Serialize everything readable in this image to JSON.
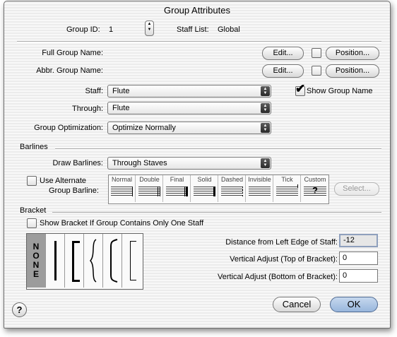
{
  "window": {
    "title": "Group Attributes"
  },
  "header": {
    "group_id_label": "Group ID:",
    "group_id_value": "1",
    "staff_list_label": "Staff List:",
    "staff_list_value": "Global"
  },
  "names": {
    "full_label": "Full Group Name:",
    "abbr_label": "Abbr. Group Name:",
    "edit_label": "Edit...",
    "position_label": "Position..."
  },
  "staff": {
    "staff_label": "Staff:",
    "staff_value": "Flute",
    "through_label": "Through:",
    "through_value": "Flute",
    "optimization_label": "Group Optimization:",
    "optimization_value": "Optimize Normally",
    "show_group_name_label": "Show Group Name",
    "show_group_name_checked": true
  },
  "barlines": {
    "section_label": "Barlines",
    "draw_label": "Draw Barlines:",
    "draw_value": "Through Staves",
    "use_alternate_label_1": "Use Alternate",
    "use_alternate_label_2": "Group Barline:",
    "styles": [
      "Normal",
      "Double",
      "Final",
      "Solid",
      "Dashed",
      "Invisible",
      "Tick",
      "Custom"
    ],
    "custom_glyph": "?",
    "select_label": "Select..."
  },
  "bracket": {
    "section_label": "Bracket",
    "show_single_label": "Show Bracket If Group Contains Only One Staff",
    "none_label": "NONE",
    "distance_label": "Distance from Left Edge of Staff:",
    "distance_value": "-12",
    "vtop_label": "Vertical Adjust (Top of Bracket):",
    "vtop_value": "0",
    "vbottom_label": "Vertical Adjust (Bottom of Bracket):",
    "vbottom_value": "0"
  },
  "footer": {
    "help_glyph": "?",
    "cancel_label": "Cancel",
    "ok_label": "OK"
  },
  "colors": {
    "default_button": "#98b6dc",
    "selected_bracket": "#9c9c9c"
  }
}
